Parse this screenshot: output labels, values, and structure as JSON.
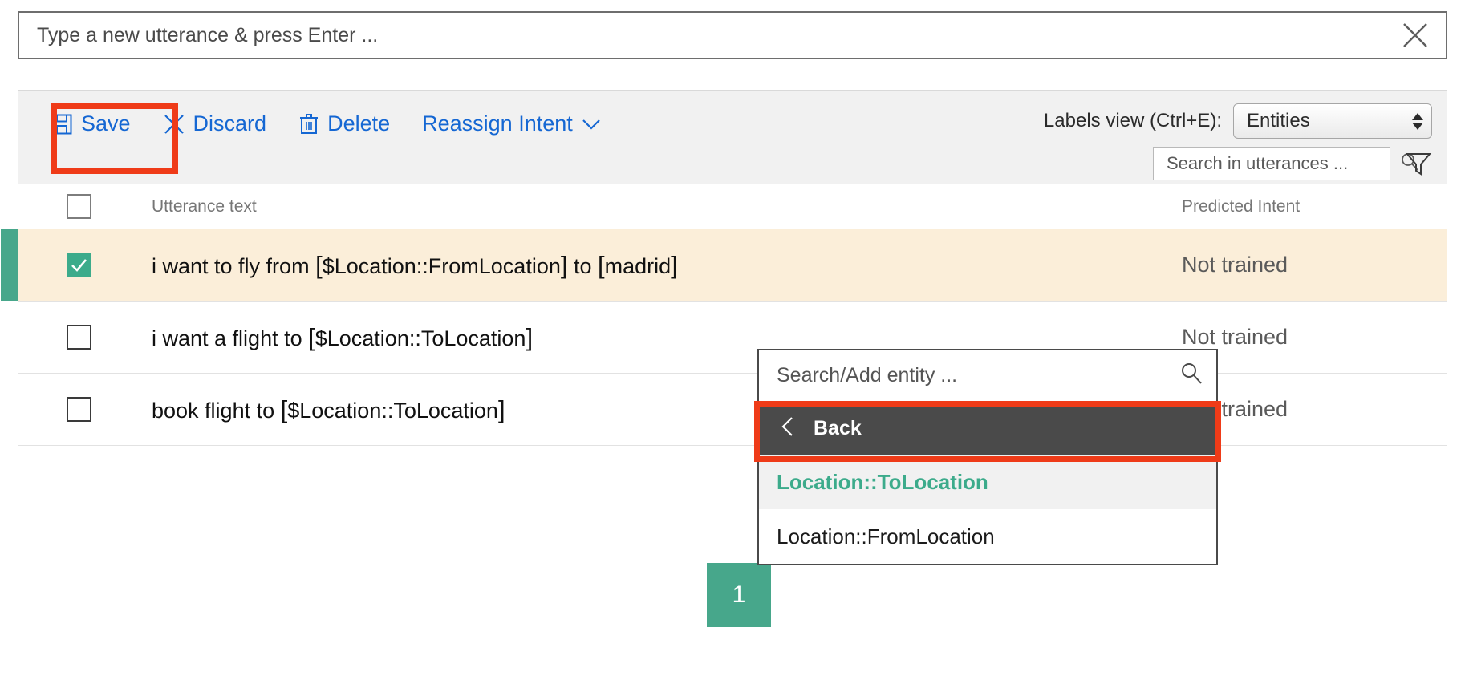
{
  "new_utterance": {
    "placeholder": "Type a new utterance & press Enter ...",
    "value": "",
    "clear_icon": "close-icon"
  },
  "toolbar": {
    "save_label": "Save",
    "save_icon": "save-floppy-icon",
    "discard_label": "Discard",
    "discard_icon": "close-x-icon",
    "delete_label": "Delete",
    "delete_icon": "trash-icon",
    "reassign_label": "Reassign Intent",
    "reassign_icon": "chevron-down-icon",
    "labels_view_label": "Labels view (Ctrl+E):",
    "labels_view_value": "Entities",
    "search_placeholder": "Search in utterances ...",
    "search_value": "",
    "search_icon": "search-icon",
    "filter_icon": "filter-funnel-icon"
  },
  "table": {
    "columns": {
      "utterance": "Utterance text",
      "intent": "Predicted Intent"
    },
    "rows": [
      {
        "selected": true,
        "checked": true,
        "segments": [
          {
            "kind": "plain",
            "text": "i want to fly from "
          },
          {
            "kind": "open",
            "text": "["
          },
          {
            "kind": "entity",
            "text": "$Location::FromLocation"
          },
          {
            "kind": "close",
            "text": "]"
          },
          {
            "kind": "plain",
            "text": " to "
          },
          {
            "kind": "open",
            "text": "["
          },
          {
            "kind": "entity",
            "text": "madrid"
          },
          {
            "kind": "close",
            "text": "]"
          }
        ],
        "intent": "Not trained"
      },
      {
        "selected": false,
        "checked": false,
        "segments": [
          {
            "kind": "plain",
            "text": "i want a flight to "
          },
          {
            "kind": "open",
            "text": "["
          },
          {
            "kind": "entity",
            "text": "$Location::ToLocation"
          },
          {
            "kind": "close",
            "text": "]"
          }
        ],
        "intent": "Not trained"
      },
      {
        "selected": false,
        "checked": false,
        "segments": [
          {
            "kind": "plain",
            "text": "book flight to "
          },
          {
            "kind": "open",
            "text": "["
          },
          {
            "kind": "entity",
            "text": "$Location::ToLocation"
          },
          {
            "kind": "close",
            "text": "]"
          }
        ],
        "intent": "Not trained"
      }
    ]
  },
  "entity_popup": {
    "search_placeholder": "Search/Add entity ...",
    "search_value": "",
    "search_icon": "search-icon",
    "back_label": "Back",
    "back_icon": "chevron-left-icon",
    "options": [
      {
        "label": "Location::ToLocation",
        "active": true
      },
      {
        "label": "Location::FromLocation",
        "active": false
      }
    ]
  },
  "step_badge": {
    "number": "1"
  },
  "colors": {
    "accent_blue": "#1567d3",
    "highlight_red": "#ef3b18",
    "green": "#47a78b",
    "selected_row": "#fbeed9",
    "dark_panel": "#4a4a4a"
  }
}
